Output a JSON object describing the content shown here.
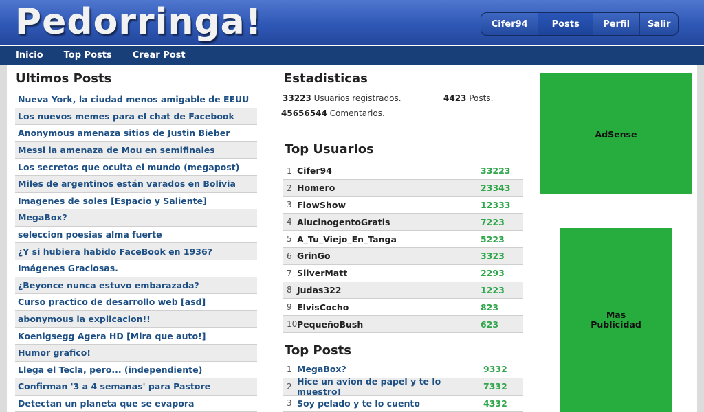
{
  "header": {
    "logo": "Pedorringa!",
    "user_nav": [
      "Cifer94",
      "Posts",
      "Perfil",
      "Salir"
    ]
  },
  "menu": [
    "Inicio",
    "Top Posts",
    "Crear Post"
  ],
  "latest": {
    "title": "Ultimos Posts",
    "posts": [
      "Nueva York, la ciudad menos amigable de EEUU",
      "Los nuevos memes para el chat de Facebook",
      "Anonymous amenaza sitios de Justin Bieber",
      "Messi la amenaza de Mou en semifinales",
      "Los secretos que oculta el mundo (megapost)",
      "Miles de argentinos están varados en Bolivia",
      "Imagenes de soles [Espacio y Saliente]",
      "MegaBox?",
      "seleccion poesias alma fuerte",
      "¿Y si hubiera habido FaceBook en 1936?",
      "Imágenes Graciosas.",
      "¿Beyonce nunca estuvo embarazada?",
      "Curso practico de desarrollo web [asd]",
      "abonymous la explicacion!!",
      "Koenigsegg Agera HD [Mira que auto!]",
      "Humor grafico!",
      "Llega el Tecla, pero... (independiente)",
      "Confirman '3 a 4 semanas' para Pastore",
      "Detectan un planeta que se evapora"
    ]
  },
  "stats": {
    "title": "Estadisticas",
    "users_count": "33223",
    "users_label": "Usuarios registrados.",
    "posts_count": "4423",
    "posts_label": "Posts.",
    "comments_count": "45656544",
    "comments_label": "Comentarios."
  },
  "top_users": {
    "title": "Top Usuarios",
    "rows": [
      {
        "rank": "1",
        "name": "Cifer94",
        "score": "33223"
      },
      {
        "rank": "2",
        "name": "Homero",
        "score": "23343"
      },
      {
        "rank": "3",
        "name": "FlowShow",
        "score": "12333"
      },
      {
        "rank": "4",
        "name": "AlucinogentoGratis",
        "score": "7223"
      },
      {
        "rank": "5",
        "name": "A_Tu_Viejo_En_Tanga",
        "score": "5223"
      },
      {
        "rank": "6",
        "name": "GrinGo",
        "score": "3323"
      },
      {
        "rank": "7",
        "name": "SilverMatt",
        "score": "2293"
      },
      {
        "rank": "8",
        "name": "Judas322",
        "score": "1223"
      },
      {
        "rank": "9",
        "name": "ElvisCocho",
        "score": "823"
      },
      {
        "rank": "10",
        "name": "PequeñoBush",
        "score": "623"
      }
    ]
  },
  "top_posts": {
    "title": "Top Posts",
    "rows": [
      {
        "rank": "1",
        "name": "MegaBox?",
        "score": "9332"
      },
      {
        "rank": "2",
        "name": "Hice un avion de papel y te lo muestro!",
        "score": "7332"
      },
      {
        "rank": "3",
        "name": "Soy pelado y te lo cuento",
        "score": "4332"
      }
    ]
  },
  "ads": {
    "ad1": "AdSense",
    "ad2": "Mas\nPublicidad"
  },
  "colors": {
    "header_blue": "#2f58b6",
    "menubar": "#183f78",
    "link": "#1d4f84",
    "score_green": "#2fa64a",
    "ad_green": "#27ad3e"
  }
}
